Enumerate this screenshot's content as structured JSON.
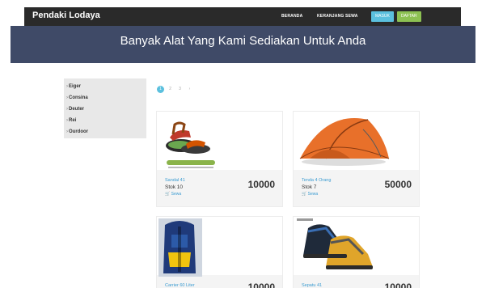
{
  "header": {
    "brand": "Pendaki Lodaya",
    "nav": {
      "beranda": "BERANDA",
      "keranjang": "KERANJANG SEWA"
    },
    "masuk": "MASUK",
    "daftar": "DAFTAR"
  },
  "hero": {
    "title": "Banyak Alat Yang Kami Sediakan Untuk Anda"
  },
  "categories": [
    {
      "label": "Eiger"
    },
    {
      "label": "Consina"
    },
    {
      "label": "Deuter"
    },
    {
      "label": "Rei"
    },
    {
      "label": "Ourdoor"
    }
  ],
  "pagination": {
    "pages": [
      "1",
      "2",
      "3"
    ],
    "active": "1",
    "next": "›"
  },
  "products": [
    {
      "name": "Sandal 41",
      "stock": "Stok 10",
      "price": "10000",
      "action": "Sewa",
      "image": "sandal-image"
    },
    {
      "name": "Tenda 4 Orang",
      "stock": "Stok 7",
      "price": "50000",
      "action": "Sewa",
      "image": "tent-image"
    },
    {
      "name": "Carrier 60 Liter",
      "stock": "",
      "price": "10000",
      "action": "",
      "image": "backpack-image"
    },
    {
      "name": "Sepatu 41",
      "stock": "",
      "price": "10000",
      "action": "",
      "image": "boots-image"
    }
  ],
  "colors": {
    "topbar": "#2a2a2a",
    "hero": "#3f4a67",
    "masuk": "#5bc0de",
    "daftar": "#8cc152",
    "link": "#3a9bd1"
  }
}
